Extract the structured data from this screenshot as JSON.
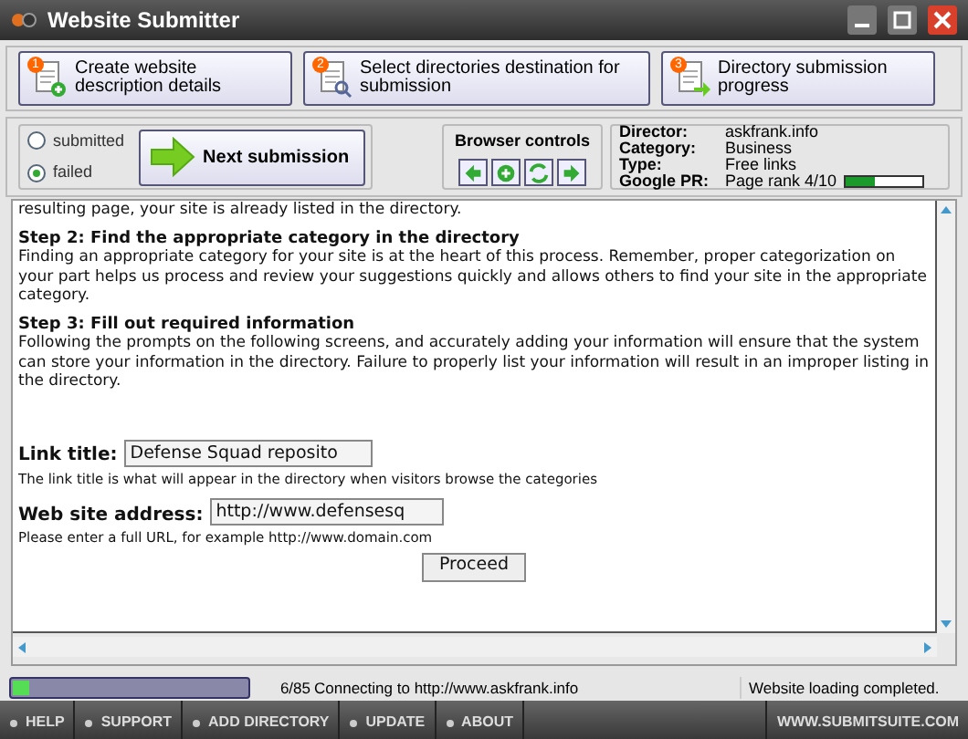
{
  "window": {
    "title": "Website Submitter"
  },
  "steps": [
    {
      "number": "1",
      "label": "Create website description details",
      "kind": "add"
    },
    {
      "number": "2",
      "label": "Select directories destination for submission",
      "kind": "search"
    },
    {
      "number": "3",
      "label": "Directory submission progress",
      "kind": "arrow"
    }
  ],
  "filter": [
    {
      "label": "submitted",
      "selected": false
    },
    {
      "label": "failed",
      "selected": true
    }
  ],
  "next_button": "Next submission",
  "browser_controls": {
    "title": "Browser controls",
    "buttons": [
      {
        "kind": "back"
      },
      {
        "kind": "add"
      },
      {
        "kind": "refresh"
      },
      {
        "kind": "forward"
      }
    ]
  },
  "info": [
    {
      "label": "Director:",
      "value": "askfrank.info"
    },
    {
      "label": "Category:",
      "value": "Business"
    },
    {
      "label": "Type:",
      "value": "Free links"
    },
    {
      "label": "Google PR:",
      "value": "Page rank 4/10",
      "level": 0.38
    }
  ],
  "page": {
    "cut_line": "resulting page, your site is already listed in the directory.",
    "sections": [
      {
        "heading": "Step 2: Find the appropriate category in the directory",
        "text": "Finding an appropriate category for your site is at the heart of this process. Remember, proper categorization on your part helps us process and review your suggestions quickly and allows others to find your site in the appropriate category."
      },
      {
        "heading": "Step 3: Fill out required information",
        "text": "Following the prompts on the following screens, and accurately adding your information will ensure that the system can store your information in the directory. Failure to properly list your information will result in an improper listing in the directory."
      }
    ],
    "fields": [
      {
        "label": "Link title:",
        "value": "Defense Squad reposito",
        "hint": "The link title is what will appear in the directory when visitors browse the categories"
      },
      {
        "label": "Web site address:",
        "value": "http://www.defensesq",
        "hint": "Please enter a full URL, for example http://www.domain.com"
      }
    ],
    "button": "Proceed"
  },
  "status_bar": {
    "level": 0.07,
    "count": "6/85",
    "message": "Connecting to http://www.askfrank.info",
    "right": "Website loading completed."
  },
  "footer": {
    "links": [
      "HELP",
      "SUPPORT",
      "ADD DIRECTORY",
      "UPDATE",
      "ABOUT"
    ],
    "site": "WWW.SUBMITSUITE.COM"
  }
}
